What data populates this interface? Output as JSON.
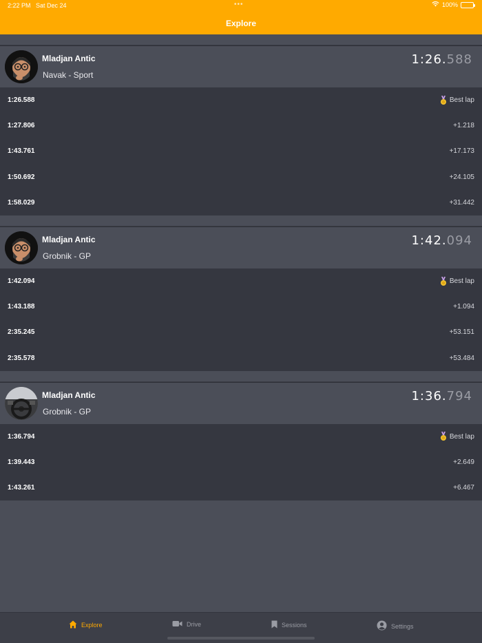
{
  "status": {
    "time": "2:22 PM",
    "date": "Sat Dec 24",
    "dots": "•••",
    "battery": "100%"
  },
  "nav": {
    "title": "Explore"
  },
  "sessions": [
    {
      "driver": "Mladjan Antic",
      "track": "Navak - Sport",
      "best_main": "1:26.",
      "best_ms": "588",
      "avatar": "memoji-avatar",
      "laps": [
        {
          "time": "1:26.588",
          "delta": "Best lap",
          "best": true
        },
        {
          "time": "1:27.806",
          "delta": "+1.218"
        },
        {
          "time": "1:43.761",
          "delta": "+17.173"
        },
        {
          "time": "1:50.692",
          "delta": "+24.105"
        },
        {
          "time": "1:58.029",
          "delta": "+31.442"
        }
      ]
    },
    {
      "driver": "Mladjan Antic",
      "track": "Grobnik - GP",
      "best_main": "1:42.",
      "best_ms": "094",
      "avatar": "memoji-avatar",
      "laps": [
        {
          "time": "1:42.094",
          "delta": "Best lap",
          "best": true
        },
        {
          "time": "1:43.188",
          "delta": "+1.094"
        },
        {
          "time": "2:35.245",
          "delta": "+53.151"
        },
        {
          "time": "2:35.578",
          "delta": "+53.484"
        }
      ]
    },
    {
      "driver": "Mladjan Antic",
      "track": "Grobnik - GP",
      "best_main": "1:36.",
      "best_ms": "794",
      "avatar": "car-interior-avatar",
      "laps": [
        {
          "time": "1:36.794",
          "delta": "Best lap",
          "best": true
        },
        {
          "time": "1:39.443",
          "delta": "+2.649"
        },
        {
          "time": "1:43.261",
          "delta": "+6.467"
        }
      ]
    }
  ],
  "tabs": [
    {
      "label": "Explore",
      "icon": "house-icon",
      "active": true
    },
    {
      "label": "Drive",
      "icon": "video-camera-icon"
    },
    {
      "label": "Sessions",
      "icon": "bookmark-icon"
    },
    {
      "label": "Settings",
      "icon": "person-circle-icon"
    }
  ],
  "colors": {
    "accent": "#ffaa00",
    "background": "#4b4e58",
    "lap_background": "#353740"
  }
}
